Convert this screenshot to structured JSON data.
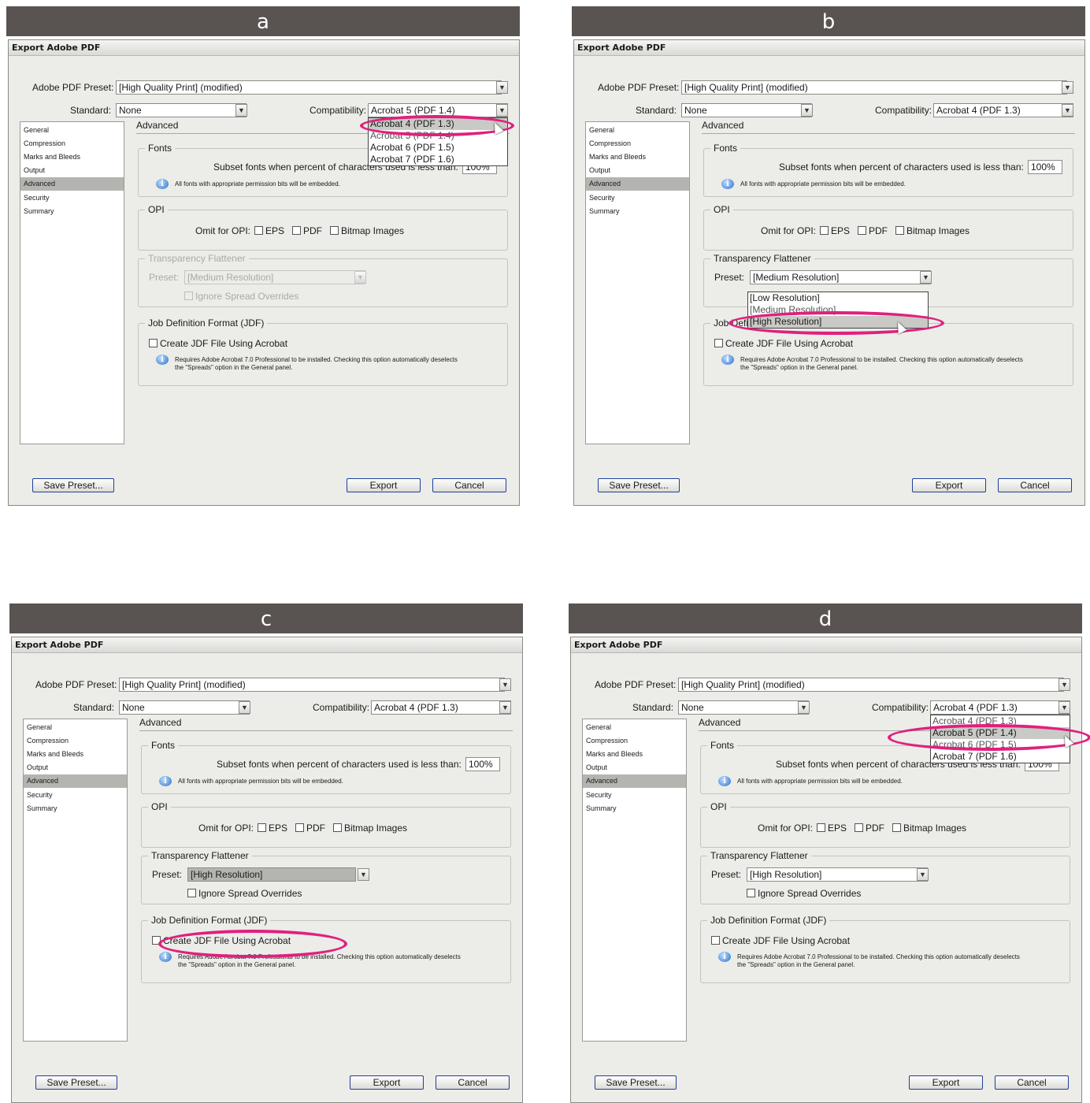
{
  "common": {
    "dialog_title": "Export Adobe PDF",
    "preset_label": "Adobe PDF Preset:",
    "preset_value": "[High Quality Print] (modified)",
    "standard_label": "Standard:",
    "standard_value": "None",
    "compat_label": "Compatibility:",
    "sidebar": [
      "General",
      "Compression",
      "Marks and Bleeds",
      "Output",
      "Advanced",
      "Security",
      "Summary"
    ],
    "section_title": "Advanced",
    "fonts_title": "Fonts",
    "subset_label": "Subset fonts when percent of characters used is less than:",
    "subset_value": "100%",
    "fonts_info": "All fonts with appropriate permission bits will be embedded.",
    "opi_title": "OPI",
    "omit_label": "Omit for OPI:",
    "eps": "EPS",
    "pdf": "PDF",
    "bitmap": "Bitmap Images",
    "flattener_title": "Transparency Flattener",
    "flattener_preset_label": "Preset:",
    "ignore_label": "Ignore Spread Overrides",
    "jdf_title": "Job Definition Format (JDF)",
    "jdf_checkbox": "Create JDF File Using Acrobat",
    "jdf_info_1": "Requires Adobe Acrobat 7.0 Professional to be installed. Checking this option automatically deselects",
    "jdf_info_2": "the \"Spreads\" option in the General panel.",
    "save_preset": "Save Preset...",
    "export": "Export",
    "cancel": "Cancel"
  },
  "panels": [
    {
      "label": "a",
      "compat_value": "Acrobat 5 (PDF 1.4)",
      "flattener_value": "[Medium Resolution]",
      "flattener_disabled": true,
      "dropdown_items": [
        "Acrobat 4 (PDF 1.3)",
        "Acrobat 5 (PDF 1.4)",
        "Acrobat 6 (PDF 1.5)",
        "Acrobat 7 (PDF 1.6)"
      ]
    },
    {
      "label": "b",
      "compat_value": "Acrobat 4 (PDF 1.3)",
      "flattener_value": "[Medium Resolution]",
      "flattener_disabled": false,
      "dropdown_items": [
        "[Low Resolution]",
        "[Medium Resolution]",
        "[High Resolution]"
      ]
    },
    {
      "label": "c",
      "compat_value": "Acrobat 4 (PDF 1.3)",
      "flattener_value": "[High Resolution]",
      "flattener_disabled": false
    },
    {
      "label": "d",
      "compat_value": "Acrobat 4 (PDF 1.3)",
      "flattener_value": "[High Resolution]",
      "flattener_disabled": false,
      "dropdown_items": [
        "Acrobat 4 (PDF 1.3)",
        "Acrobat 5 (PDF 1.4)",
        "Acrobat 6 (PDF 1.5)",
        "Acrobat 7 (PDF 1.6)"
      ]
    }
  ],
  "accent_color": "#e0207e",
  "header_color": "#595451"
}
